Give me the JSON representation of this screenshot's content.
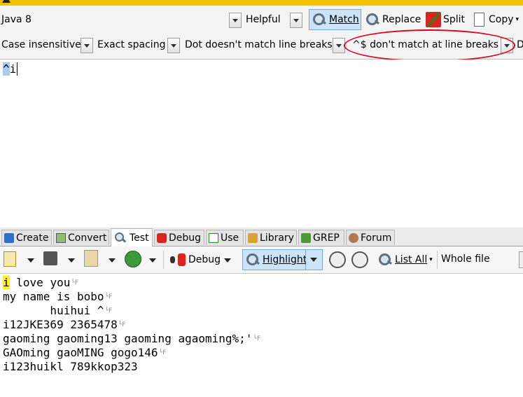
{
  "toolbar1": {
    "flavor": "Java 8",
    "operation": "Helpful",
    "match_label": "Match",
    "replace_label": "Replace",
    "split_label": "Split",
    "copy_label": "Copy"
  },
  "options": {
    "case": "Case insensitive",
    "spacing": "Exact spacing",
    "dot": "Dot doesn't match line breaks",
    "anchors": "^$ don't match at line breaks",
    "next_stub": "D"
  },
  "regex": {
    "selected": "^",
    "rest": "i"
  },
  "tabs": [
    {
      "label": "Create"
    },
    {
      "label": "Convert"
    },
    {
      "label": "Test"
    },
    {
      "label": "Debug"
    },
    {
      "label": "Use"
    },
    {
      "label": "Library"
    },
    {
      "label": "GREP"
    },
    {
      "label": "Forum"
    }
  ],
  "test_toolbar": {
    "debug_label": "Debug",
    "highlight_label": "Highlight",
    "list_all_label": "List All",
    "scope": "Whole file"
  },
  "subject_lines": [
    {
      "match": "i",
      "rest": " love you"
    },
    {
      "match": "",
      "rest": "my name is bobo"
    },
    {
      "match": "",
      "rest": "       huihui ^"
    },
    {
      "match": "",
      "rest": "i12JKE369 2365478"
    },
    {
      "match": "",
      "rest": "gaoming gaoming13 gaoming agaoming%;'"
    },
    {
      "match": "",
      "rest": "GAOming gaoMING gogo146"
    },
    {
      "match": "",
      "rest": "i123huikl 789kkop323"
    }
  ],
  "colors": {
    "accent": "#f2c200",
    "pressed": "#cde3f7",
    "annotation": "#e0001a",
    "match_highlight": "#ffee22"
  }
}
